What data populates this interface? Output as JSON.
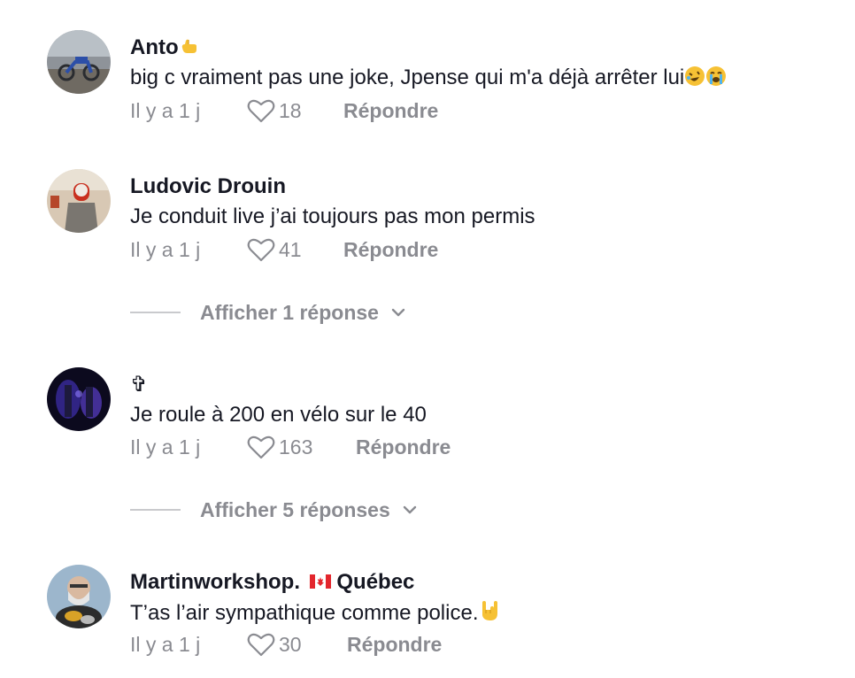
{
  "comments": [
    {
      "author": "Anto",
      "author_emoji": "call-me-hand",
      "text": "big c vraiment pas une joke, Jpense qui m'a déjà arrêter lui",
      "text_emojis": [
        "rolling-on-floor-laughing",
        "loudly-crying-face"
      ],
      "time": "Il y a 1 j",
      "likes": "18",
      "reply": "Répondre"
    },
    {
      "author": "Ludovic Drouin",
      "text": "Je conduit live j’ai toujours pas mon permis",
      "time": "Il y a 1 j",
      "likes": "41",
      "reply": "Répondre",
      "view_replies": "Afficher 1 réponse"
    },
    {
      "author": "✞",
      "text": "Je roule à 200 en vélo sur le 40",
      "time": "Il y a 1 j",
      "likes": "163",
      "reply": "Répondre",
      "view_replies": "Afficher 5 réponses"
    },
    {
      "author": "Martinworkshop.",
      "author_flag": "canada-flag",
      "author_suffix": "Québec",
      "text": "T’as l’air sympathique comme police.",
      "text_emojis": [
        "sign-of-the-horns"
      ],
      "time": "Il y a 1 j",
      "likes": "30",
      "reply": "Répondre"
    }
  ],
  "colors": {
    "primary_text": "#161823",
    "secondary_text": "#8a8b91",
    "divider": "#c9cacd",
    "emoji_yellow": "#f6c134",
    "flag_red": "#e3262d"
  }
}
